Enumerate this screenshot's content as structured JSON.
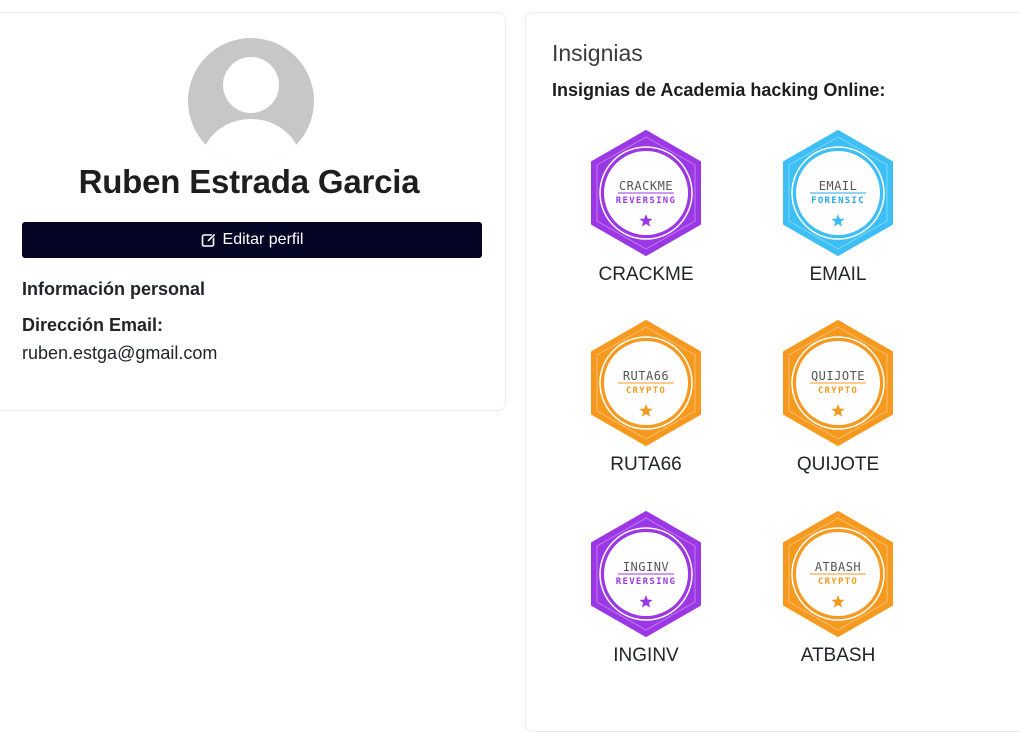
{
  "profile": {
    "name": "Ruben Estrada Garcia",
    "edit_button": "Editar perfil",
    "section_title": "Información personal",
    "email_label": "Dirección Email:",
    "email_value": "ruben.estga@gmail.com"
  },
  "badges_section": {
    "title": "Insignias",
    "subtitle": "Insignias de Academia hacking Online:",
    "items": [
      {
        "label": "CRACKME",
        "emblem_text": "CRACKME",
        "category": "REVERSING",
        "color": "#9b37e4",
        "cat_color": "#9b37e4"
      },
      {
        "label": "EMAIL",
        "emblem_text": "EMAIL",
        "category": "FORENSIC",
        "color": "#3dbff5",
        "cat_color": "#2aa9e0"
      },
      {
        "label": "RUTA66",
        "emblem_text": "RUTA66",
        "category": "CRYPTO",
        "color": "#f59a1f",
        "cat_color": "#f59a1f"
      },
      {
        "label": "QUIJOTE",
        "emblem_text": "QUIJOTE",
        "category": "CRYPTO",
        "color": "#f59a1f",
        "cat_color": "#f59a1f"
      },
      {
        "label": "INGINV",
        "emblem_text": "INGINV",
        "category": "REVERSING",
        "color": "#9b37e4",
        "cat_color": "#9b37e4"
      },
      {
        "label": "ATBASH",
        "emblem_text": "ATBASH",
        "category": "CRYPTO",
        "color": "#f59a1f",
        "cat_color": "#f59a1f"
      }
    ]
  }
}
